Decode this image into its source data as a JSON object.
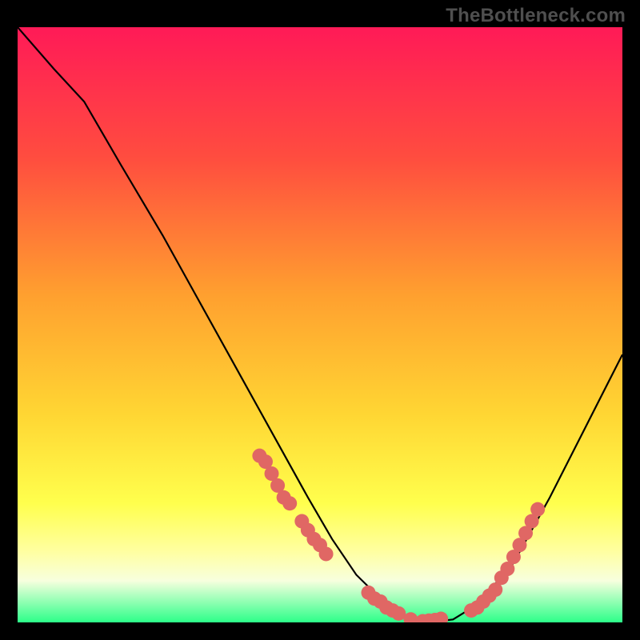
{
  "watermark": "TheBottleneck.com",
  "colors": {
    "frame": "#000000",
    "gradient_top": "#ff1a57",
    "gradient_upper": "#ff4d3f",
    "gradient_mid": "#ffa02f",
    "gradient_lower": "#ffd633",
    "gradient_yellow": "#ffff4d",
    "gradient_paleyellow": "#ffffa0",
    "gradient_ivory": "#f7ffde",
    "gradient_bottom": "#2cff89",
    "curve": "#000000",
    "dots": "#e06764"
  },
  "chart_data": {
    "type": "line",
    "title": "",
    "xlabel": "",
    "ylabel": "",
    "xlim": [
      0,
      100
    ],
    "ylim": [
      0,
      100
    ],
    "series": [
      {
        "name": "bottleneck-curve",
        "x": [
          0,
          6,
          11,
          17,
          24,
          30,
          36,
          42,
          48,
          52,
          56,
          60,
          64,
          68,
          72,
          76,
          82,
          88,
          94,
          100
        ],
        "y": [
          100,
          93,
          87.5,
          77,
          65,
          54,
          43,
          32,
          21,
          14,
          8,
          4,
          1,
          0,
          0.5,
          3,
          10,
          21,
          33,
          45
        ]
      }
    ],
    "dot_clusters": [
      {
        "name": "left-cluster",
        "points": [
          [
            40,
            28
          ],
          [
            41,
            27
          ],
          [
            42,
            25
          ],
          [
            43,
            23
          ],
          [
            44,
            21
          ],
          [
            45,
            20
          ],
          [
            47,
            17
          ],
          [
            48,
            15.5
          ],
          [
            49,
            14
          ],
          [
            50,
            13
          ],
          [
            51,
            11.5
          ],
          [
            58,
            5
          ],
          [
            59,
            4
          ],
          [
            60,
            3.5
          ],
          [
            61,
            2.5
          ],
          [
            62,
            2
          ],
          [
            63,
            1.5
          ],
          [
            65,
            0.5
          ],
          [
            67,
            0.2
          ],
          [
            68,
            0.3
          ],
          [
            69,
            0.4
          ],
          [
            70,
            0.6
          ]
        ]
      },
      {
        "name": "right-cluster",
        "points": [
          [
            75,
            2.0
          ],
          [
            76,
            2.5
          ],
          [
            77,
            3.5
          ],
          [
            78,
            4.5
          ],
          [
            79,
            5.5
          ],
          [
            80,
            7.5
          ],
          [
            81,
            9.0
          ],
          [
            82,
            11.0
          ],
          [
            83,
            13.0
          ],
          [
            84,
            15.0
          ],
          [
            85,
            17.0
          ],
          [
            86,
            19.0
          ]
        ]
      }
    ]
  }
}
